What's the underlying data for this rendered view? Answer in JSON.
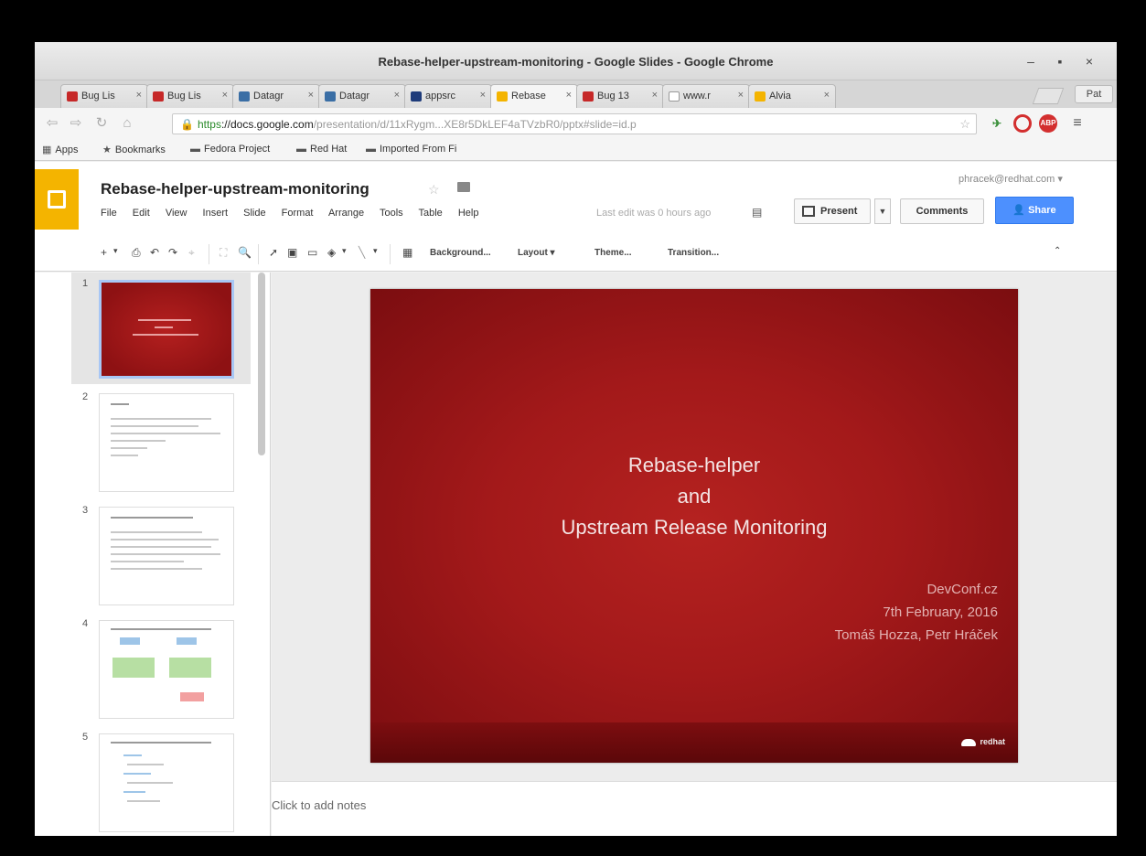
{
  "window": {
    "title": "Rebase-helper-upstream-monitoring - Google Slides - Google Chrome",
    "controls": [
      "–",
      "▪",
      "×"
    ]
  },
  "tabs": [
    {
      "label": "Bug Lis",
      "icon_color": "#c62828"
    },
    {
      "label": "Bug Lis",
      "icon_color": "#c62828"
    },
    {
      "label": "Datagr",
      "icon_color": "#3a6ea5"
    },
    {
      "label": "Datagr",
      "icon_color": "#3a6ea5"
    },
    {
      "label": "appsrc",
      "icon_color": "#1e3b7a"
    },
    {
      "label": "Rebase",
      "icon_color": "#f4b400"
    },
    {
      "label": "Bug 13",
      "icon_color": "#c62828"
    },
    {
      "label": "www.r",
      "icon_color": "#ffffff"
    },
    {
      "label": "Alvia",
      "icon_color": "#f4b400"
    }
  ],
  "profile_label": "Pat",
  "address": {
    "https": "https",
    "domain": "://docs.google.com",
    "path": "/presentation/d/11xRygm...XE8r5DkLEF4aTVzbR0/pptx#slide=id.p"
  },
  "bookmarks": [
    {
      "label": "Apps",
      "icon": "apps-icon"
    },
    {
      "label": "Bookmarks",
      "icon": "star-icon"
    },
    {
      "label": "Fedora Project",
      "icon": "folder-icon"
    },
    {
      "label": "Red Hat",
      "icon": "folder-icon"
    },
    {
      "label": "Imported From Fi",
      "icon": "folder-icon"
    }
  ],
  "doc": {
    "title": "Rebase-helper-upstream-monitoring",
    "menu": [
      "File",
      "Edit",
      "View",
      "Insert",
      "Slide",
      "Format",
      "Arrange",
      "Tools",
      "Table",
      "Help"
    ],
    "last_edit": "Last edit was 0 hours ago",
    "user_email": "phracek@redhat.com ▾",
    "present_label": "Present",
    "comments_label": "Comments",
    "share_label": "Share"
  },
  "toolbar": {
    "background_label": "Background...",
    "layout_label": "Layout ▾",
    "theme_label": "Theme...",
    "transition_label": "Transition..."
  },
  "slides": [
    {
      "number": "1"
    },
    {
      "number": "2"
    },
    {
      "number": "3"
    },
    {
      "number": "4"
    },
    {
      "number": "5"
    }
  ],
  "current_slide": {
    "title_line1": "Rebase-helper",
    "title_line2": "and",
    "title_line3": "Upstream Release Monitoring",
    "sub_line1": "DevConf.cz",
    "sub_line2": "7th February, 2016",
    "sub_line3": "Tomáš Hozza, Petr Hráček",
    "logo_text": "redhat"
  },
  "notes_placeholder": "Click to add notes"
}
